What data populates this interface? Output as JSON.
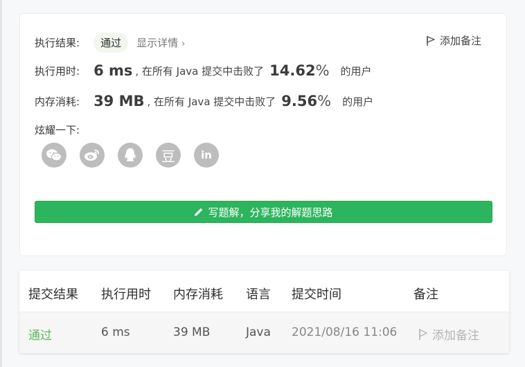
{
  "result": {
    "label": "执行结果:",
    "status": "通过",
    "details_link": "显示详情",
    "chevron": "›",
    "add_note": "添加备注"
  },
  "runtime": {
    "label": "执行用时:",
    "value": "6 ms",
    "middle": ", 在所有 Java 提交中击败了",
    "percent": "14.62",
    "percent_sign": "%",
    "suffix": "的用户"
  },
  "memory": {
    "label": "内存消耗:",
    "value": "39 MB",
    "middle": ", 在所有 Java 提交中击败了",
    "percent": "9.56",
    "percent_sign": "%",
    "suffix": "的用户"
  },
  "share": {
    "label": "炫耀一下:",
    "icons": [
      "wechat-icon",
      "weibo-icon",
      "qq-icon",
      "douban-icon",
      "linkedin-icon"
    ],
    "douban_glyph": "豆",
    "linkedin_glyph": "in"
  },
  "solution_button": {
    "label": "写题解，分享我的解题思路"
  },
  "table": {
    "headers": [
      "提交结果",
      "执行用时",
      "内存消耗",
      "语言",
      "提交时间",
      "备注"
    ],
    "rows": [
      {
        "status": "通过",
        "runtime": "6 ms",
        "memory": "39 MB",
        "language": "Java",
        "time": "2021/08/16 11:06",
        "note": "添加备注"
      }
    ]
  },
  "colors": {
    "accent_green": "#2db55d",
    "pass_green": "#5cb85c",
    "icon_gray": "#bdbdbd"
  }
}
